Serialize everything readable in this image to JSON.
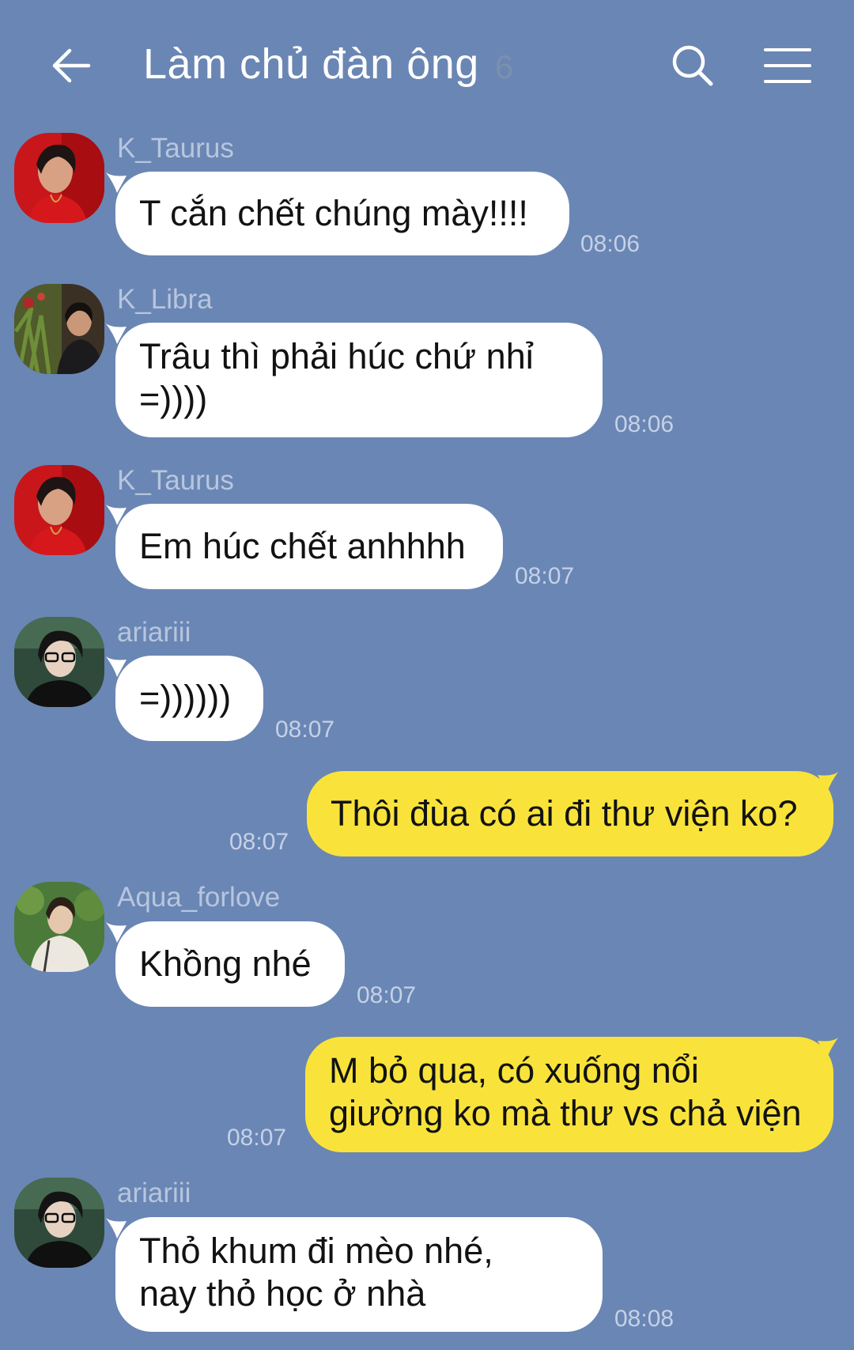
{
  "header": {
    "title": "Làm chủ đàn ông",
    "member_count": "6",
    "back_icon": "arrow-left-icon",
    "search_icon": "search-icon",
    "menu_icon": "hamburger-menu-icon"
  },
  "colors": {
    "background": "#6a86b4",
    "incoming_bubble": "#ffffff",
    "outgoing_bubble": "#f9e33a"
  },
  "messages": [
    {
      "sender": "K_Taurus",
      "text": "T cắn chết chúng mày!!!!",
      "time": "08:06"
    },
    {
      "sender": "K_Libra",
      "text": "Trâu thì phải húc chứ nhỉ\n=))))",
      "time": "08:06"
    },
    {
      "sender": "K_Taurus",
      "text": "Em húc chết anhhhh",
      "time": "08:07"
    },
    {
      "sender": "ariariii",
      "text": "=))))))",
      "time": "08:07"
    },
    {
      "text": "Thôi đùa có ai đi thư viện ko?",
      "time": "08:07"
    },
    {
      "sender": "Aqua_forlove",
      "text": "Khồng nhé",
      "time": "08:07"
    },
    {
      "text": "M bỏ qua, có xuống nổi\ngiường ko mà thư vs chả viện",
      "time": "08:07"
    },
    {
      "sender": "ariariii",
      "text": "Thỏ khum đi mèo nhé,\nnay thỏ học ở nhà",
      "time": "08:08"
    }
  ]
}
